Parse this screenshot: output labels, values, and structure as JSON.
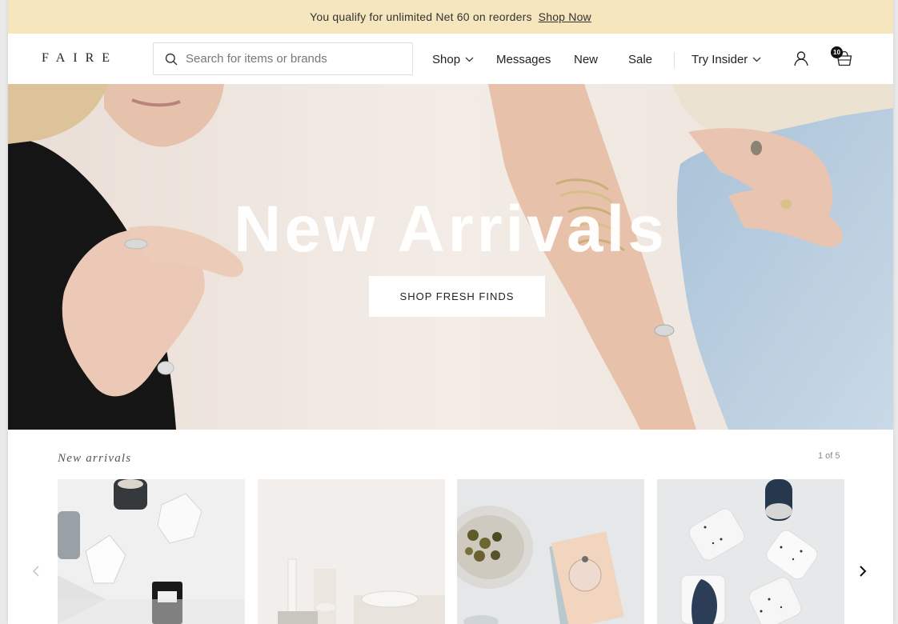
{
  "promo": {
    "text": "You qualify for unlimited Net 60 on reorders",
    "link": "Shop Now"
  },
  "header": {
    "logo": "FAIRE",
    "search_placeholder": "Search for items or brands",
    "nav": {
      "shop": "Shop",
      "messages": "Messages",
      "new": "New",
      "sale": "Sale",
      "insider": "Try Insider"
    },
    "cart_count": "10"
  },
  "hero": {
    "title": "New Arrivals",
    "cta": "SHOP FRESH FINDS"
  },
  "new_arrivals": {
    "title": "New arrivals",
    "pager": "1 of 5",
    "cards": [
      {
        "image": "candles-and-boxes"
      },
      {
        "image": "candle-holders"
      },
      {
        "image": "capers-bowl-and-card"
      },
      {
        "image": "speckled-cups"
      }
    ]
  },
  "colors": {
    "promo_bg": "#f6e6bd",
    "hero_bg": "#efe7e0",
    "text_dark": "#222222"
  }
}
